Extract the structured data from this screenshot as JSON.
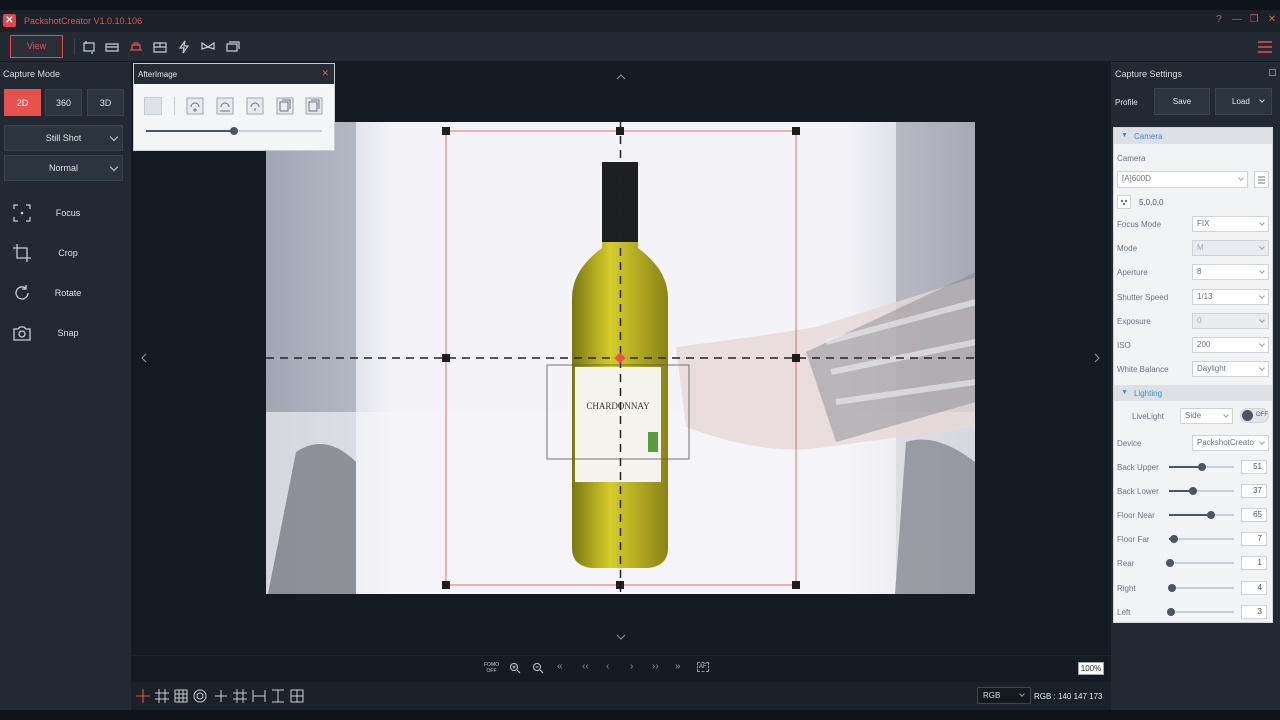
{
  "app": {
    "title": "PackshotCreator V1.0.10.106",
    "logo": "✕",
    "window_buttons": [
      "?",
      "—",
      "❐",
      "✕"
    ]
  },
  "toolbar": {
    "view_label": "View",
    "icons": [
      "crop-tool-icon",
      "tray-icon",
      "turntable-icon",
      "box-icon",
      "flash-icon",
      "butterfly-icon",
      "layers-icon"
    ]
  },
  "left_panel": {
    "title": "Capture Mode",
    "modes": [
      "2D",
      "360",
      "3D"
    ],
    "active_mode": "2D",
    "shot_type": "Still Shot",
    "quality": "Normal",
    "tools": [
      "Focus",
      "Crop",
      "Rotate",
      "Snap"
    ]
  },
  "afterimage": {
    "title": "AfterImage",
    "close": "✕",
    "slider_value": 0.5
  },
  "photo": {
    "label_brand": "CHARDONNAY"
  },
  "bottom_bar": {
    "fomo": "FOMO",
    "off": "OFF",
    "af": "AF",
    "zoom": "100%"
  },
  "status_bar": {
    "color_mode": "RGB",
    "rgb_readout": "RGB : 140 147 173"
  },
  "right_panel": {
    "title": "Capture Settings",
    "profile_label": "Profile",
    "save_label": "Save",
    "load_label": "Load",
    "camera_section": "Camera",
    "camera_label": "Camera",
    "camera_value": "[A]600D",
    "coords": "5,0,0,0",
    "settings": [
      {
        "label": "Focus Mode",
        "value": "FIX",
        "disabled": false
      },
      {
        "label": "Mode",
        "value": "M",
        "disabled": true
      },
      {
        "label": "Aperture",
        "value": "8",
        "disabled": false
      },
      {
        "label": "Shutter Speed",
        "value": "1/13",
        "disabled": false
      },
      {
        "label": "Exposure",
        "value": "0",
        "disabled": true
      },
      {
        "label": "ISO",
        "value": "200",
        "disabled": false
      },
      {
        "label": "White Balance",
        "value": "Daylight",
        "disabled": false
      }
    ],
    "lighting_section": "Lighting",
    "livelight_label": "LiveLight",
    "livelight_value": "Side",
    "livelight_toggle": "OFF",
    "device_label": "Device",
    "device_value": "PackshotCreato",
    "lights": [
      {
        "label": "Back Upper",
        "value": 51
      },
      {
        "label": "Back Lower",
        "value": 37
      },
      {
        "label": "Floor Near",
        "value": 65
      },
      {
        "label": "Floor Far",
        "value": 7
      },
      {
        "label": "Rear",
        "value": 1
      },
      {
        "label": "Right",
        "value": 4
      },
      {
        "label": "Left",
        "value": 3
      }
    ]
  },
  "colors": {
    "accent": "#e8514d",
    "link": "#3b8fd8",
    "panel": "#222932"
  }
}
